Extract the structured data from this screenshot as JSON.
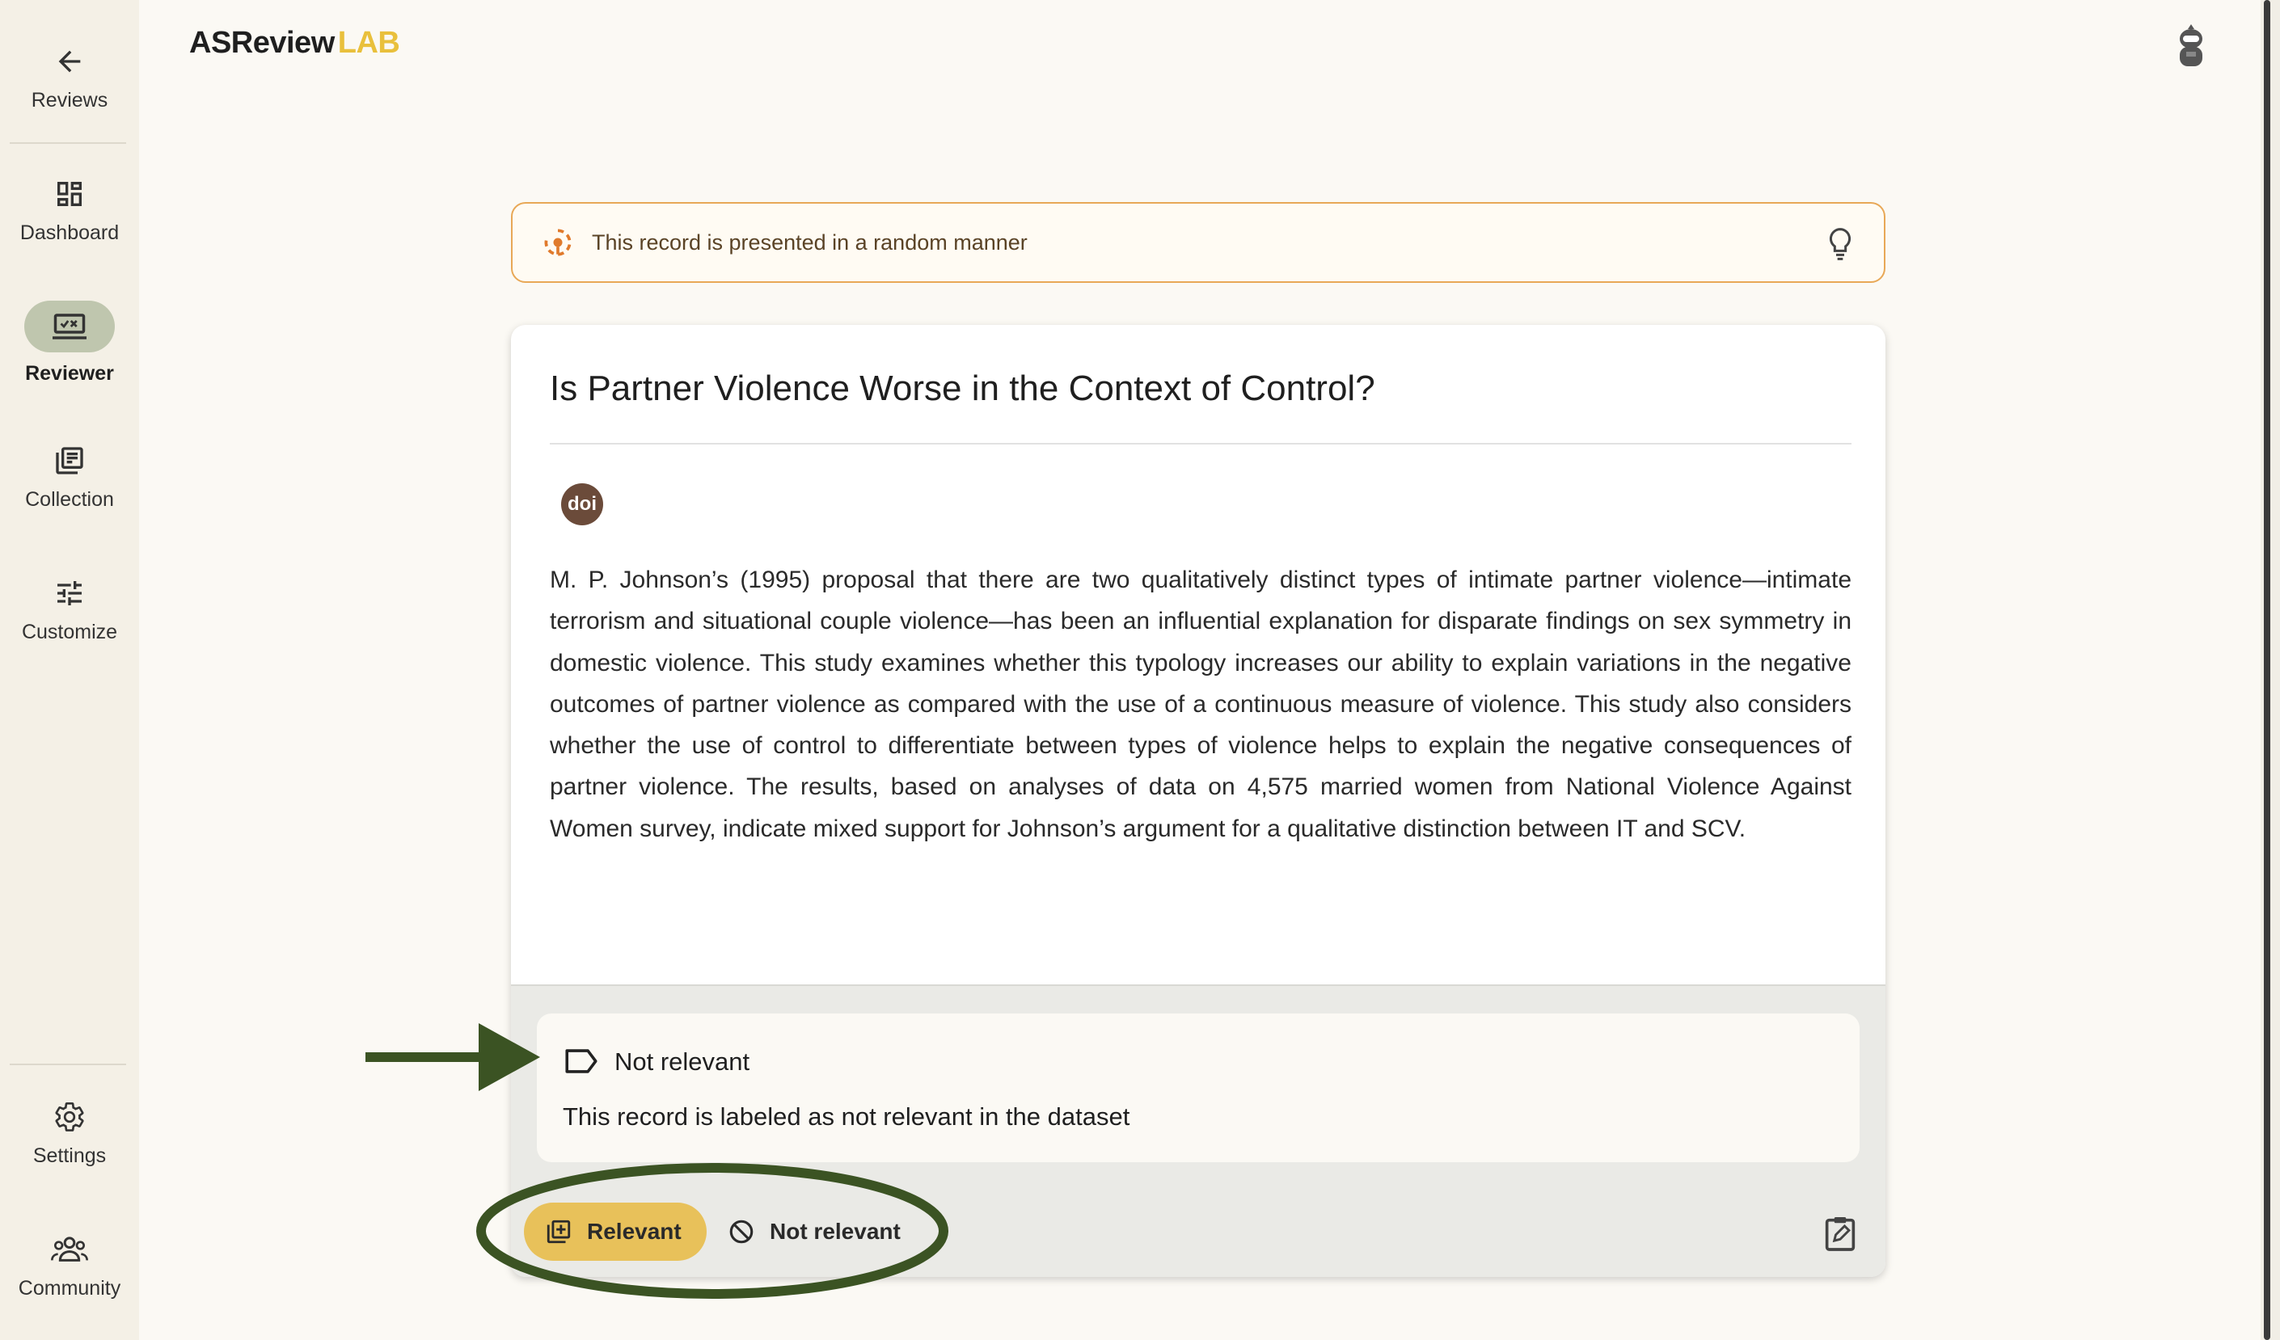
{
  "app": {
    "brand_main": "ASReview",
    "brand_accent": "LAB"
  },
  "sidebar": {
    "items": [
      {
        "label": "Reviews",
        "icon": "arrow-back-icon"
      },
      {
        "label": "Dashboard",
        "icon": "dashboard-icon"
      },
      {
        "label": "Reviewer",
        "icon": "reviewer-icon",
        "active": true
      },
      {
        "label": "Collection",
        "icon": "collection-icon"
      },
      {
        "label": "Customize",
        "icon": "tune-icon"
      },
      {
        "label": "Settings",
        "icon": "gear-icon"
      },
      {
        "label": "Community",
        "icon": "community-icon"
      }
    ]
  },
  "banner": {
    "text": "This record is presented in a random manner",
    "icon": "random-icon",
    "hint_icon": "lightbulb-icon"
  },
  "record": {
    "title": "Is Partner Violence Worse in the Context of Control?",
    "doi_badge": "doi",
    "abstract": "M. P. Johnson’s (1995) proposal that there are two qualitatively distinct types of intimate partner violence—intimate terrorism and situational couple violence—has been an influential explanation for disparate findings on sex symmetry in domestic violence. This study examines whether this typology increases our ability to explain variations in the negative outcomes of partner violence as compared with the use of a continuous measure of violence. This study also considers whether the use of control to differentiate between types of violence helps to explain the negative consequences of partner violence. The results, based on analyses of data on 4,575 married women from National Violence Against Women survey, indicate mixed support for Johnson’s argument for a qualitative distinction between IT and SCV."
  },
  "dataset_label": {
    "tag": "Not relevant",
    "description": "This record is labeled as not relevant in the dataset"
  },
  "actions": {
    "relevant_label": "Relevant",
    "not_relevant_label": "Not relevant"
  },
  "colors": {
    "accent": "#E9C03C",
    "banner_border": "#E8A857",
    "annotation": "#3B5323",
    "active_nav": "#BFC6AE"
  }
}
